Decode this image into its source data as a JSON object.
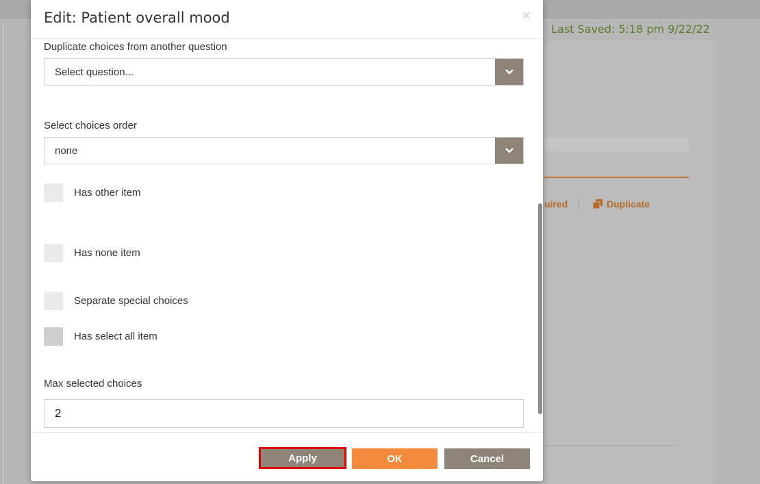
{
  "background": {
    "last_saved": "Last Saved: 5:18 pm 9/22/22",
    "required_partial": "uired",
    "duplicate_label": "Duplicate",
    "accent_color": "#b56a28"
  },
  "modal": {
    "title": "Edit: Patient overall mood",
    "close_glyph": "×",
    "duplicate_choices": {
      "label": "Duplicate choices from another question",
      "value": "Select question..."
    },
    "choices_order": {
      "label": "Select choices order",
      "value": "none"
    },
    "checkboxes": [
      {
        "label": "Has other item",
        "checked": false
      },
      {
        "label": "Has none item",
        "checked": false
      },
      {
        "label": "Separate special choices",
        "checked": false
      },
      {
        "label": "Has select all item",
        "checked": false
      }
    ],
    "max_selected": {
      "label": "Max selected choices",
      "value": "2"
    },
    "buttons": {
      "apply": "Apply",
      "ok": "OK",
      "cancel": "Cancel"
    }
  },
  "colors": {
    "button_gray": "#8f8478",
    "button_orange": "#f48a3b",
    "highlight_red": "#e00000",
    "saved_green": "#5a7a27"
  }
}
